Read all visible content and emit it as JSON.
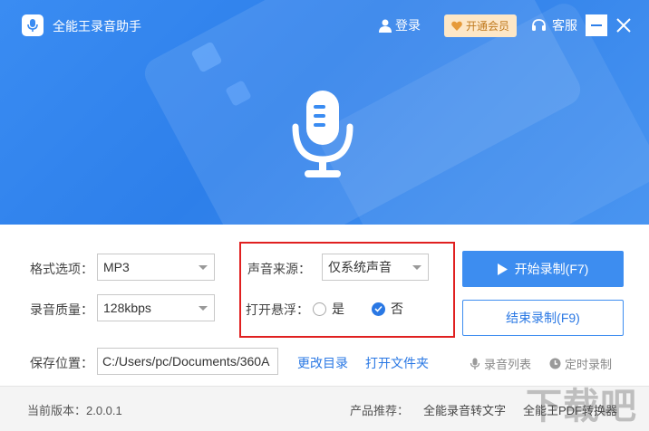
{
  "header": {
    "app_title": "全能王录音助手",
    "login_label": "登录",
    "vip_label": "开通会员",
    "service_label": "客服"
  },
  "form": {
    "format_label": "格式选项：",
    "format_value": "MP3",
    "quality_label": "录音质量：",
    "quality_value": "128kbps",
    "source_label": "声音来源：",
    "source_value": "仅系统声音",
    "float_label": "打开悬浮：",
    "float_yes": "是",
    "float_no": "否",
    "save_label": "保存位置：",
    "save_path": "C:/Users/pc/Documents/360A",
    "change_dir": "更改目录",
    "open_folder": "打开文件夹"
  },
  "actions": {
    "start_label": "开始录制(F7)",
    "stop_label": "结束录制(F9)",
    "list_label": "录音列表",
    "timer_label": "定时录制"
  },
  "footer": {
    "version": "当前版本：2.0.0.1",
    "recommend_label": "产品推荐：",
    "product1": "全能录音转文字",
    "product2": "全能王PDF转换器"
  },
  "watermark": "下载吧",
  "colors": {
    "accent": "#2d7fea",
    "highlight_box": "#e02020",
    "vip_bg": "#fde7c7"
  },
  "icons": [
    "mic-logo-icon",
    "user-icon",
    "vip-heart-icon",
    "headset-icon",
    "minimize-icon",
    "close-icon",
    "microphone-icon",
    "play-icon",
    "check-icon",
    "list-icon",
    "clock-icon"
  ]
}
